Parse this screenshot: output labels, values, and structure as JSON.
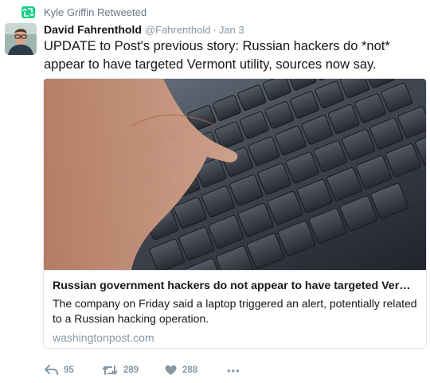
{
  "retweet_context": {
    "text": "Kyle Griffin Retweeted",
    "icon": "retweet-icon",
    "color": "#19cf86"
  },
  "author": {
    "display_name": "David Fahrenthold",
    "handle": "@Fahrenthold",
    "separator": "·",
    "timestamp": "Jan 3"
  },
  "tweet": {
    "text": "UPDATE to Post's previous story: Russian hackers do *not* appear to have targeted Vermont utility, sources now say."
  },
  "card": {
    "image": "keyboard-photo",
    "title": "Russian government hackers do not appear to have targeted Vermon...",
    "description": "The company on Friday said a laptop triggered an alert, potentially related to a Russian hacking operation.",
    "domain": "washingtonpost.com"
  },
  "actions": {
    "reply": {
      "icon": "reply-icon",
      "count": "95"
    },
    "retweet": {
      "icon": "retweet-icon",
      "count": "289"
    },
    "like": {
      "icon": "heart-icon",
      "count": "288"
    },
    "more": {
      "icon": "more-icon",
      "label": "•••"
    }
  },
  "colors": {
    "text": "#14171a",
    "muted": "#8899a6",
    "border": "#e1e8ed",
    "retweet_green": "#19cf86"
  }
}
